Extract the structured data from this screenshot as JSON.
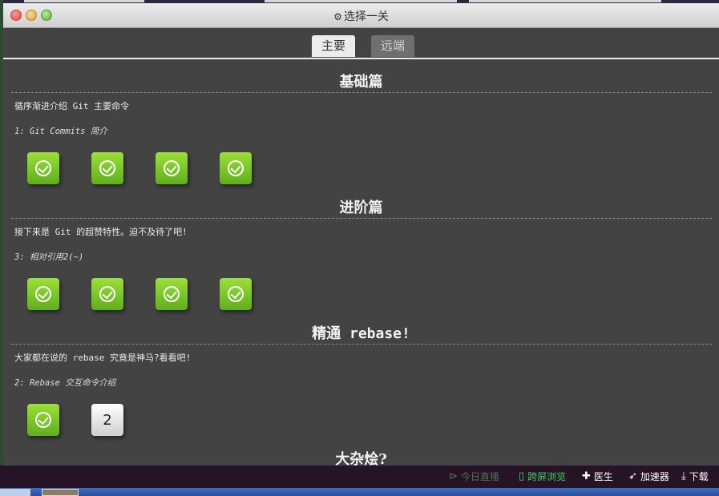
{
  "window": {
    "title": "选择一关",
    "title_icon": "gear-icon"
  },
  "tabs": [
    {
      "label": "主要",
      "active": true
    },
    {
      "label": "远端",
      "active": false
    }
  ],
  "sections": [
    {
      "title": "基础篇",
      "description": "循序渐进介绍 Git 主要命令",
      "subtitle": "1: Git Commits 简介",
      "levels": [
        {
          "completed": true
        },
        {
          "completed": true
        },
        {
          "completed": true
        },
        {
          "completed": true
        }
      ]
    },
    {
      "title": "进阶篇",
      "description": "接下来是 Git 的超赞特性。迫不及待了吧!",
      "subtitle": "3: 相对引用2(~)",
      "levels": [
        {
          "completed": true
        },
        {
          "completed": true
        },
        {
          "completed": true
        },
        {
          "completed": true
        }
      ]
    },
    {
      "title": "精通 rebase!",
      "description": "大家都在说的 rebase 究竟是神马?看看吧!",
      "subtitle": "2: Rebase 交互命令介绍",
      "levels": [
        {
          "completed": true
        },
        {
          "completed": false,
          "label": "2"
        }
      ]
    },
    {
      "title": "大杂烩?"
    }
  ],
  "bottom_bar": {
    "items": [
      {
        "label": "今日直播",
        "icon": "play-circle-icon",
        "color": "#4f6f4f"
      },
      {
        "label": "跨屏浏览",
        "icon": "phone-icon",
        "color": "#3fcf5f"
      },
      {
        "label": "医生",
        "icon": "medical-cross-icon",
        "color": "#ffffff"
      },
      {
        "label": "加速器",
        "icon": "rocket-icon",
        "color": "#ffffff"
      },
      {
        "label": "下载",
        "icon": "download-icon",
        "color": "#ffffff"
      }
    ]
  },
  "colors": {
    "panel": "#434343",
    "done_level": "#7cc72a",
    "todo_level": "#eeeeee"
  }
}
